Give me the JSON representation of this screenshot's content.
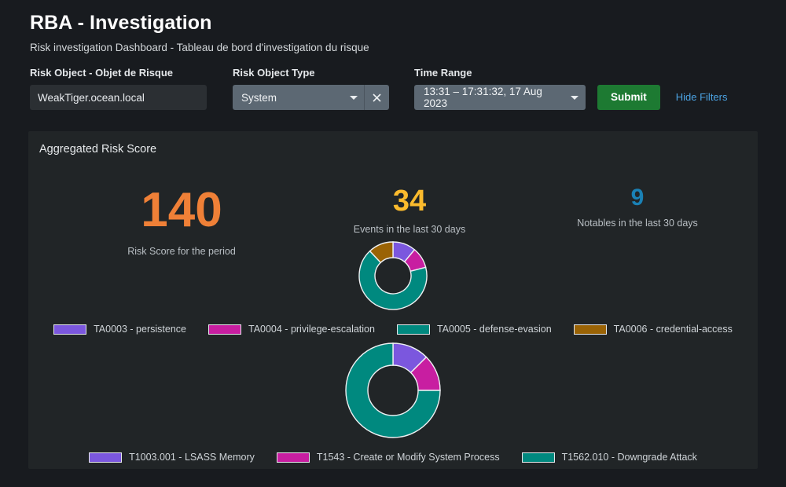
{
  "header": {
    "title": "RBA - Investigation",
    "subtitle": "Risk investigation Dashboard - Tableau de bord d'investigation du risque"
  },
  "filters": {
    "risk_object": {
      "label": "Risk Object - Objet de Risque",
      "value": "WeakTiger.ocean.local",
      "placeholder": ""
    },
    "risk_object_type": {
      "label": "Risk Object Type",
      "value": "System",
      "caret_icon": "chevron-down-icon",
      "clear_icon": "close-icon"
    },
    "time_range": {
      "label": "Time Range",
      "value": "13:31 – 17:31:32, 17 Aug 2023",
      "caret_icon": "chevron-down-icon"
    },
    "submit_label": "Submit",
    "hide_filters_label": "Hide Filters"
  },
  "panel": {
    "title": "Aggregated Risk Score",
    "metrics": [
      {
        "value": "140",
        "caption": "Risk Score for the period",
        "color": "#ef8037"
      },
      {
        "value": "34",
        "caption": "Events in the last 30 days",
        "color": "#fbbb2d"
      },
      {
        "value": "9",
        "caption": "Notables in the last 30 days",
        "color": "#1a81b5"
      }
    ]
  },
  "colors": {
    "page_background": "#181b1f",
    "panel_background": "#212527",
    "purple": "#7b57de",
    "magenta": "#c81ea1",
    "teal": "#00897f",
    "gold": "#9a6305",
    "submit_green": "#1d7a32",
    "link_blue": "#4ba3e3",
    "control_grey": "#5c6873"
  },
  "chart_data": [
    {
      "type": "pie",
      "title": "",
      "donut": true,
      "legend_position": "bottom",
      "categories": [
        "TA0003 - persistence",
        "TA0004 - privilege-escalation",
        "TA0005 - defense-evasion",
        "TA0006 - credential-access"
      ],
      "values": [
        11,
        10,
        67,
        12
      ],
      "colors": [
        "#7b57de",
        "#c81ea1",
        "#00897f",
        "#9a6305"
      ]
    },
    {
      "type": "pie",
      "title": "",
      "donut": true,
      "legend_position": "bottom",
      "categories": [
        "T1003.001 - LSASS Memory",
        "T1543 - Create or Modify System Process",
        "T1562.010 - Downgrade Attack"
      ],
      "values": [
        12.5,
        12.5,
        75
      ],
      "colors": [
        "#7b57de",
        "#c81ea1",
        "#00897f"
      ]
    }
  ]
}
